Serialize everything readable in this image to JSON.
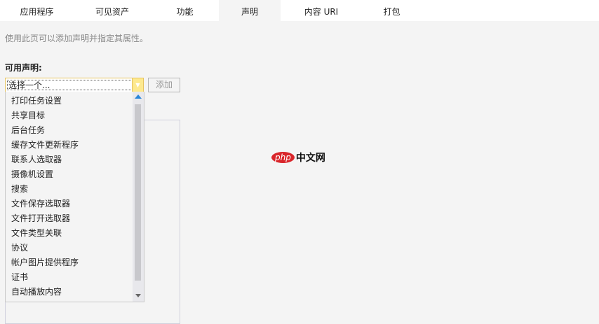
{
  "tabs": [
    "应用程序",
    "可见资产",
    "功能",
    "声明",
    "内容 URI",
    "打包"
  ],
  "active_tab": "声明",
  "description": "使用此页可以添加声明并指定其属性。",
  "available_label": "可用声明:",
  "select_value": "选择一个...",
  "add_button": "添加",
  "options": [
    "打印任务设置",
    "共享目标",
    "后台任务",
    "缓存文件更新程序",
    "联系人选取器",
    "摄像机设置",
    "搜索",
    "文件保存选取器",
    "文件打开选取器",
    "文件类型关联",
    "协议",
    "帐户图片提供程序",
    "证书",
    "自动播放内容"
  ],
  "watermark": {
    "php": "php",
    "cn": "中文网"
  }
}
